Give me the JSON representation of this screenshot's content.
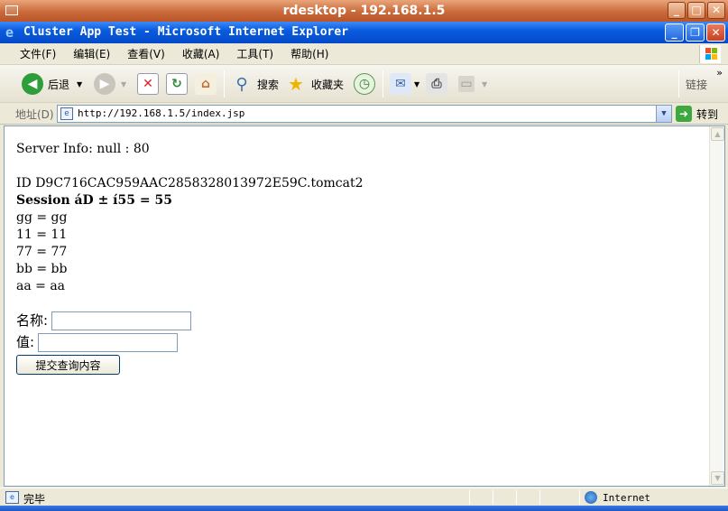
{
  "rdesktop": {
    "title": "rdesktop - 192.168.1.5"
  },
  "window": {
    "title": "Cluster App Test - Microsoft Internet Explorer"
  },
  "menu": [
    "文件(F)",
    "编辑(E)",
    "查看(V)",
    "收藏(A)",
    "工具(T)",
    "帮助(H)"
  ],
  "toolbar": {
    "back": "后退",
    "search": "搜索",
    "favorites": "收藏夹",
    "links": "链接"
  },
  "address": {
    "label": "地址(D)",
    "url": "http://192.168.1.5/index.jsp",
    "go": "转到"
  },
  "page": {
    "server_info": "Server Info: null : 80",
    "session_id": "ID D9C716CAC959AAC2858328013972E59C.tomcat2",
    "session_line": "Session áD ± í55 = 55",
    "attributes": [
      "gg = gg",
      "11 = 11",
      "77 = 77",
      "bb = bb",
      "aa = aa"
    ],
    "name_label": "名称:",
    "value_label": "值:",
    "submit": "提交查询内容"
  },
  "status": {
    "text": "完毕",
    "zone": "Internet"
  },
  "colors": {
    "ie_title": "#0a5ce0",
    "rdesktop_title": "#c96a3a",
    "chrome": "#ece9d8"
  }
}
